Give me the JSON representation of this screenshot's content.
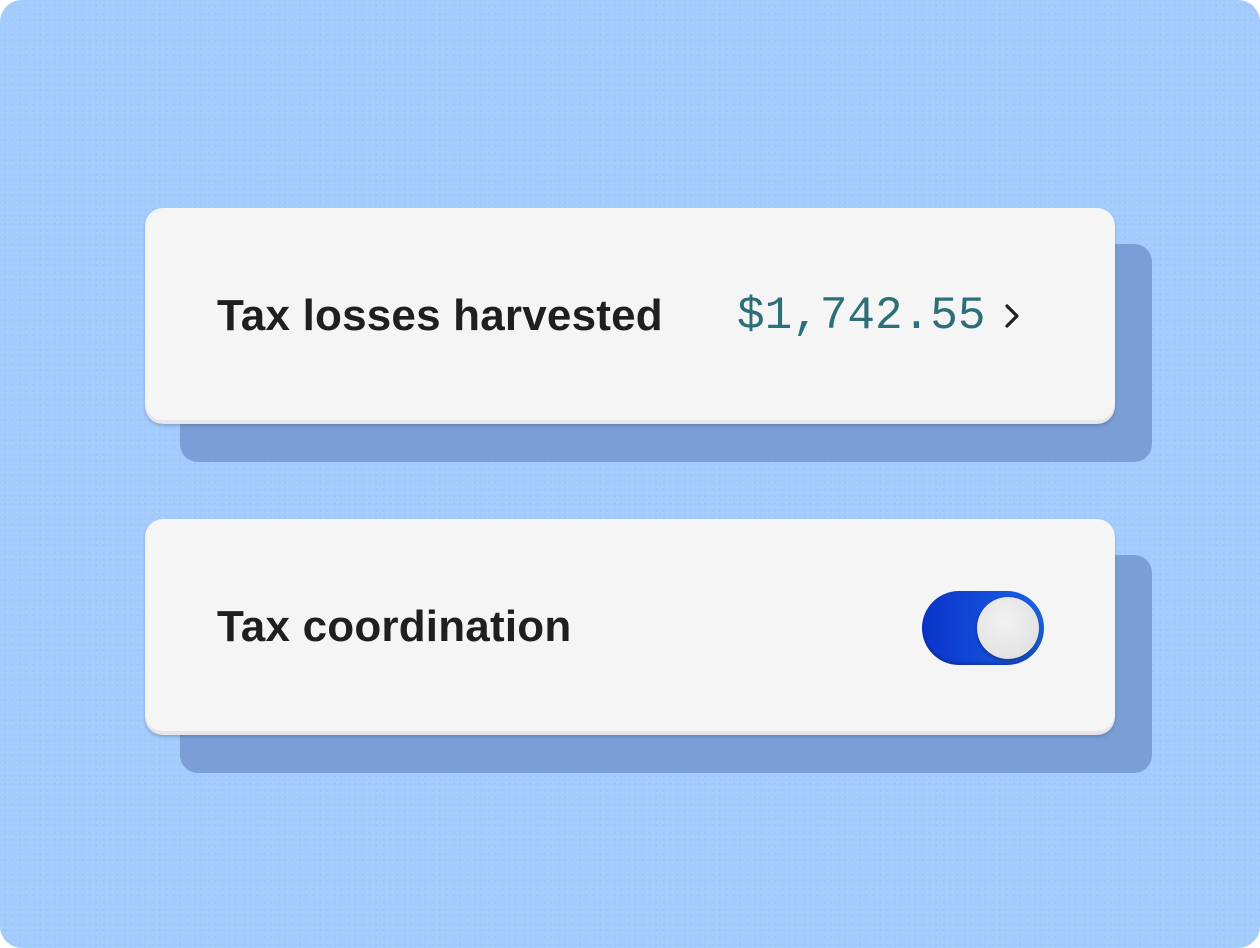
{
  "settings": {
    "tax_losses": {
      "label": "Tax losses harvested",
      "value": "$1,742.55",
      "action_icon": "chevron-right-icon"
    },
    "tax_coordination": {
      "label": "Tax coordination",
      "toggle_state": "on",
      "toggle_color": "#1448d6"
    }
  },
  "colors": {
    "background": "#a3cbfd",
    "card": "#f5f5f5",
    "card_shadow": "#7b9ed6",
    "value_text": "#2b6f78",
    "label_text": "#1f1f1f"
  }
}
